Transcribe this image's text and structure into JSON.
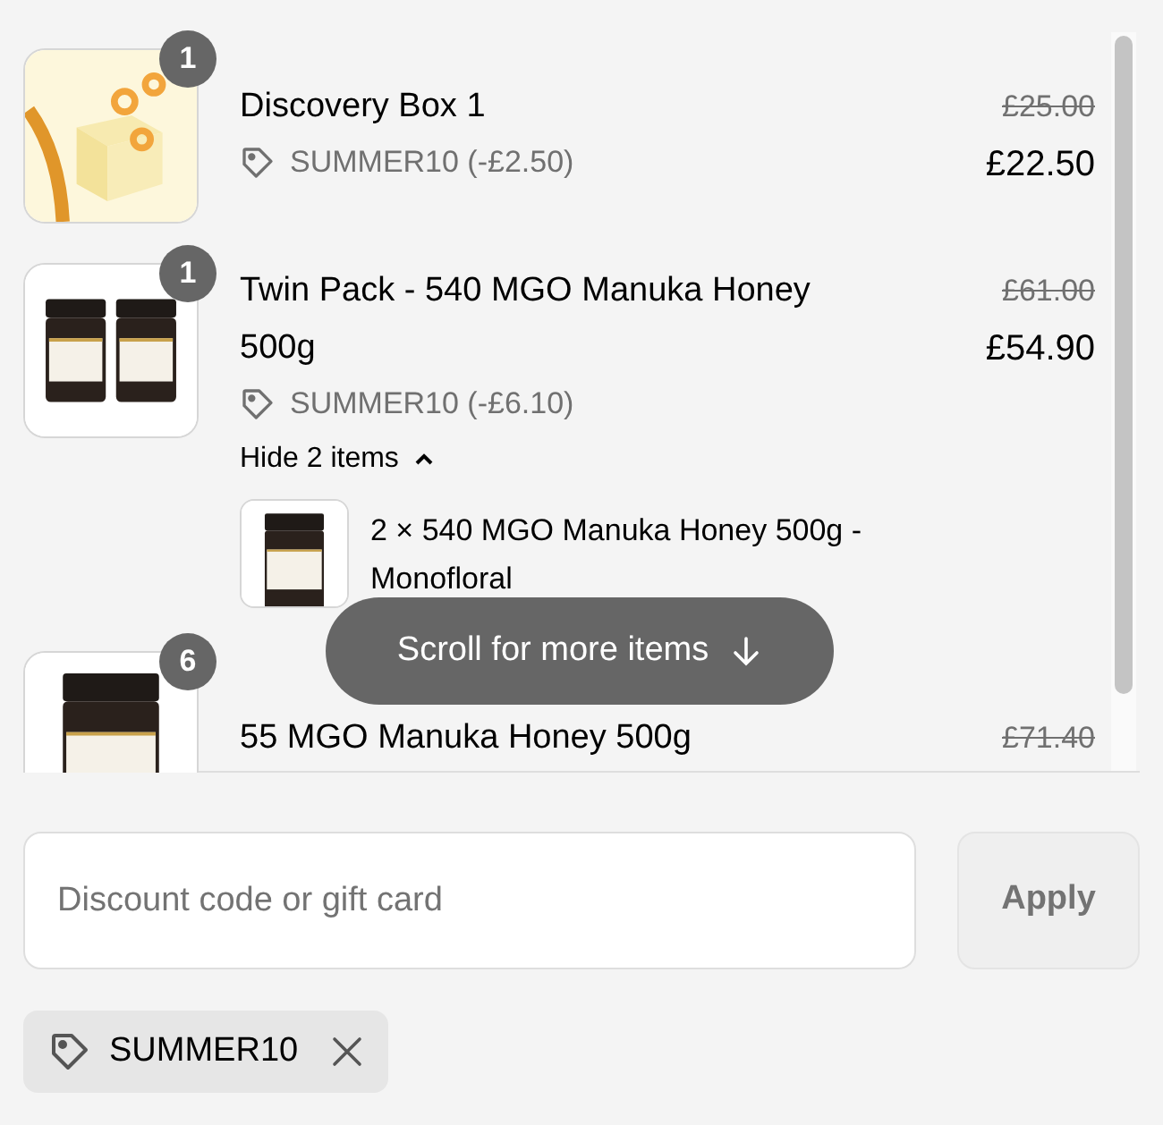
{
  "items": [
    {
      "kind": "box",
      "quantity": "1",
      "title": "Discovery Box 1",
      "discount": "SUMMER10 (-£2.50)",
      "compare_price": "£25.00",
      "price": "£22.50"
    },
    {
      "kind": "twin_jars",
      "quantity": "1",
      "title": "Twin Pack - 540 MGO Manuka Honey 500g",
      "discount": "SUMMER10 (-£6.10)",
      "compare_price": "£61.00",
      "price": "£54.90",
      "toggle": "Hide 2 items",
      "expanded": true,
      "components": [
        {
          "title": "2 × 540 MGO Manuka Honey 500g - Monofloral"
        }
      ]
    },
    {
      "kind": "jar",
      "quantity": "6",
      "title": "55 MGO Manuka Honey 500g",
      "compare_price": "£71.40"
    }
  ],
  "scroll_hint": "Scroll for more items",
  "discount_field": {
    "placeholder": "Discount code or gift card"
  },
  "apply_button": {
    "label": "Apply",
    "disabled": true
  },
  "applied_codes": [
    {
      "code": "SUMMER10"
    }
  ]
}
